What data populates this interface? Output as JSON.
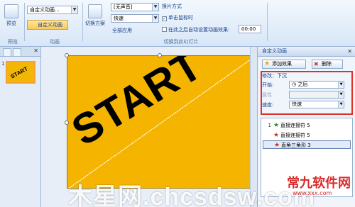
{
  "ribbon": {
    "preview_label": "预览",
    "preview_group": "预览",
    "anim_style_combo": "自定义动画...",
    "custom_anim_button": "自定义动画",
    "anim_group": "动画",
    "switch_scheme_label": "切换方案",
    "sound_value": "[无声音]",
    "speed_value": "快速",
    "apply_all_label": "全部应用",
    "switch_mode_label": "换片方式",
    "on_click_label": "单击鼠标时",
    "after_time_label": "在此之后自动设置动画效果:",
    "after_time_value": "00:00",
    "transition_group": "切换到此幻灯片"
  },
  "leftpane": {
    "slide_number": "1",
    "thumb_text": "START"
  },
  "slide": {
    "text": "START"
  },
  "taskpane": {
    "title": "自定义动画",
    "add_effect": "添加效果",
    "remove": "删除",
    "modify_label": "修改：下沉",
    "start_label": "开始:",
    "start_value": "之后",
    "property_label": "属性",
    "speed_label": "速度:",
    "speed_value": "快速",
    "items": [
      {
        "num": "1",
        "name": "直接连接符 5",
        "color": "#2e8b2e"
      },
      {
        "num": "",
        "name": "直接连接符 5",
        "color": "#c0392b"
      },
      {
        "num": "",
        "name": "直角三角形 3",
        "color": "#c0392b"
      }
    ]
  },
  "watermark": {
    "main": "木星网.chcsdsw.com",
    "logo": "常九软件网",
    "logo_sub": "www.xxx.com"
  }
}
